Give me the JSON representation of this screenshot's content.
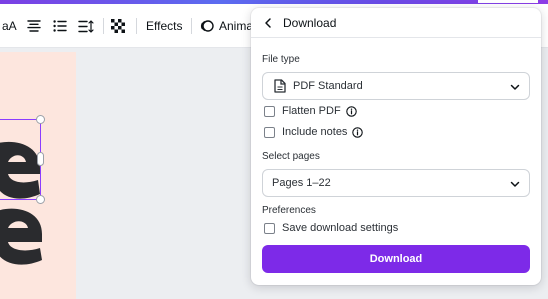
{
  "toolbar": {
    "text_case_label": "aA",
    "effects_label": "Effects",
    "animate_label": "Animat"
  },
  "canvas": {
    "page_bg": "#fde6de",
    "selection_color": "#8b3dff"
  },
  "panel": {
    "title": "Download",
    "file_type": {
      "label": "File type",
      "selected": "PDF Standard",
      "icon": "document-icon"
    },
    "options": [
      {
        "label": "Flatten PDF",
        "checked": false,
        "has_info": true
      },
      {
        "label": "Include notes",
        "checked": false,
        "has_info": true
      }
    ],
    "select_pages": {
      "label": "Select pages",
      "selected": "Pages 1–22"
    },
    "preferences": {
      "label": "Preferences",
      "save_settings_label": "Save download settings",
      "checked": false
    },
    "download_button": "Download",
    "accent_color": "#7d2ae8"
  }
}
